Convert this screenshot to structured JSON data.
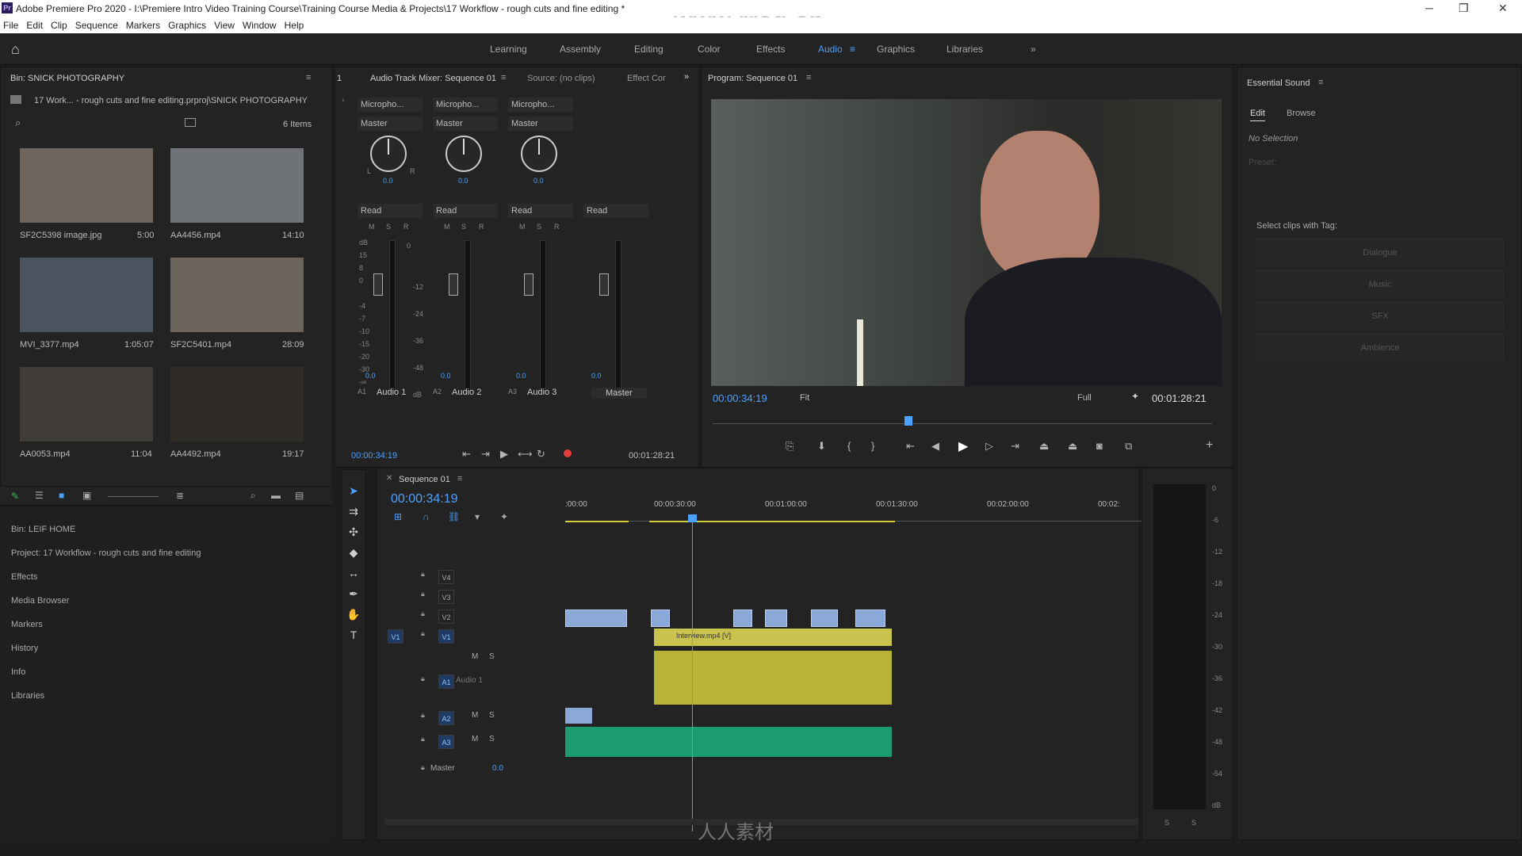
{
  "titlebar": {
    "app_icon": "Pr",
    "title": "Adobe Premiere Pro 2020 - I:\\Premiere Intro Video Training Course\\Training Course Media & Projects\\17 Workflow - rough cuts and fine editing *",
    "watermark": "www.rrcg.cn",
    "min": "─",
    "max": "❐",
    "close": "✕"
  },
  "menu": [
    "File",
    "Edit",
    "Clip",
    "Sequence",
    "Markers",
    "Graphics",
    "View",
    "Window",
    "Help"
  ],
  "workspaces": {
    "items": [
      "Learning",
      "Assembly",
      "Editing",
      "Color",
      "Effects",
      "Audio",
      "Graphics",
      "Libraries"
    ],
    "active": "Audio",
    "more": "»"
  },
  "bin": {
    "title": "Bin: SNICK PHOTOGRAPHY",
    "path": "17 Work... - rough cuts and fine editing.prproj\\SNICK PHOTOGRAPHY",
    "count": "6 Items",
    "items": [
      {
        "name": "SF2C5398 image.jpg",
        "dur": "5:00",
        "color": "#6b655c"
      },
      {
        "name": "AA4456.mp4",
        "dur": "14:10",
        "color": "#6f7378"
      },
      {
        "name": "MVI_3377.mp4",
        "dur": "1:05:07",
        "color": "#4d5260"
      },
      {
        "name": "SF2C5401.mp4",
        "dur": "28:09",
        "color": "#6a645a"
      },
      {
        "name": "AA0053.mp4",
        "dur": "11:04",
        "color": "#3f3b36"
      },
      {
        "name": "AA4492.mp4",
        "dur": "19:17",
        "color": "#2f2b27"
      }
    ]
  },
  "project_nav": [
    "Bin: LEIF HOME",
    "Project: 17 Workflow - rough cuts and fine editing",
    "Effects",
    "Media Browser",
    "Markers",
    "History",
    "Info",
    "Libraries"
  ],
  "mixer": {
    "tab_num": "1",
    "tabs": [
      "Audio Track Mixer: Sequence 01",
      "Source: (no clips)",
      "Effect Cor"
    ],
    "more": "»",
    "strips": [
      {
        "input": "Micropho...",
        "output": "Master",
        "knob": "0.0",
        "auto": "Read",
        "vol": "0.0",
        "id": "A1",
        "name": "Audio 1"
      },
      {
        "input": "Micropho...",
        "output": "Master",
        "knob": "0.0",
        "auto": "Read",
        "vol": "0.0",
        "id": "A2",
        "name": "Audio 2"
      },
      {
        "input": "Micropho...",
        "output": "Master",
        "knob": "0.0",
        "auto": "Read",
        "vol": "0.0",
        "id": "A3",
        "name": "Audio 3"
      },
      {
        "input": "",
        "output": "",
        "knob": "",
        "auto": "Read",
        "vol": "0.0",
        "id": "",
        "name": "Master"
      }
    ],
    "msr": [
      "M",
      "S",
      "R"
    ],
    "db_left": [
      "dB",
      "15",
      "8",
      "0",
      "-4",
      "-7",
      "-10",
      "-15",
      "-20",
      "-30",
      "-∞"
    ],
    "db_right": [
      "0",
      "-12",
      "-24",
      "-36",
      "-48",
      "dB"
    ],
    "time_left": "00:00:34:19",
    "time_right": "00:01:28:21",
    "L": "L",
    "R": "R"
  },
  "program": {
    "title": "Program: Sequence 01",
    "timecode": "00:00:34:19",
    "fit": "Fit",
    "quality": "Full",
    "duration": "00:01:28:21",
    "plus": "+"
  },
  "essential": {
    "title": "Essential Sound",
    "tabs": [
      "Edit",
      "Browse"
    ],
    "no_selection": "No Selection",
    "preset_label": "Preset:",
    "tag_label": "Select clips with Tag:",
    "tags": [
      "Dialogue",
      "Music",
      "SFX",
      "Ambience"
    ]
  },
  "timeline": {
    "title": "Sequence 01",
    "timecode": "00:00:34:19",
    "ruler": [
      ":00:00",
      "00:00:30:00",
      "00:01:00:00",
      "00:01:30:00",
      "00:02:00:00",
      "00:02:"
    ],
    "vtracks": [
      "V4",
      "V3",
      "V2",
      "V1"
    ],
    "src_v": "V1",
    "src_a": "A1",
    "atracks": [
      "A1",
      "A2",
      "A3"
    ],
    "audio1_name": "Audio 1",
    "master_label": "Master",
    "master_val": "0.0",
    "clip_label": "Interview.mp4 [V]",
    "ms": [
      "M",
      "S"
    ]
  },
  "meter_right": {
    "ticks": [
      "0",
      "-6",
      "-12",
      "-18",
      "-24",
      "-30",
      "-36",
      "-42",
      "-48",
      "-54",
      "dB"
    ],
    "solo": [
      "S",
      "S"
    ]
  },
  "footer_watermark": "人人素材"
}
